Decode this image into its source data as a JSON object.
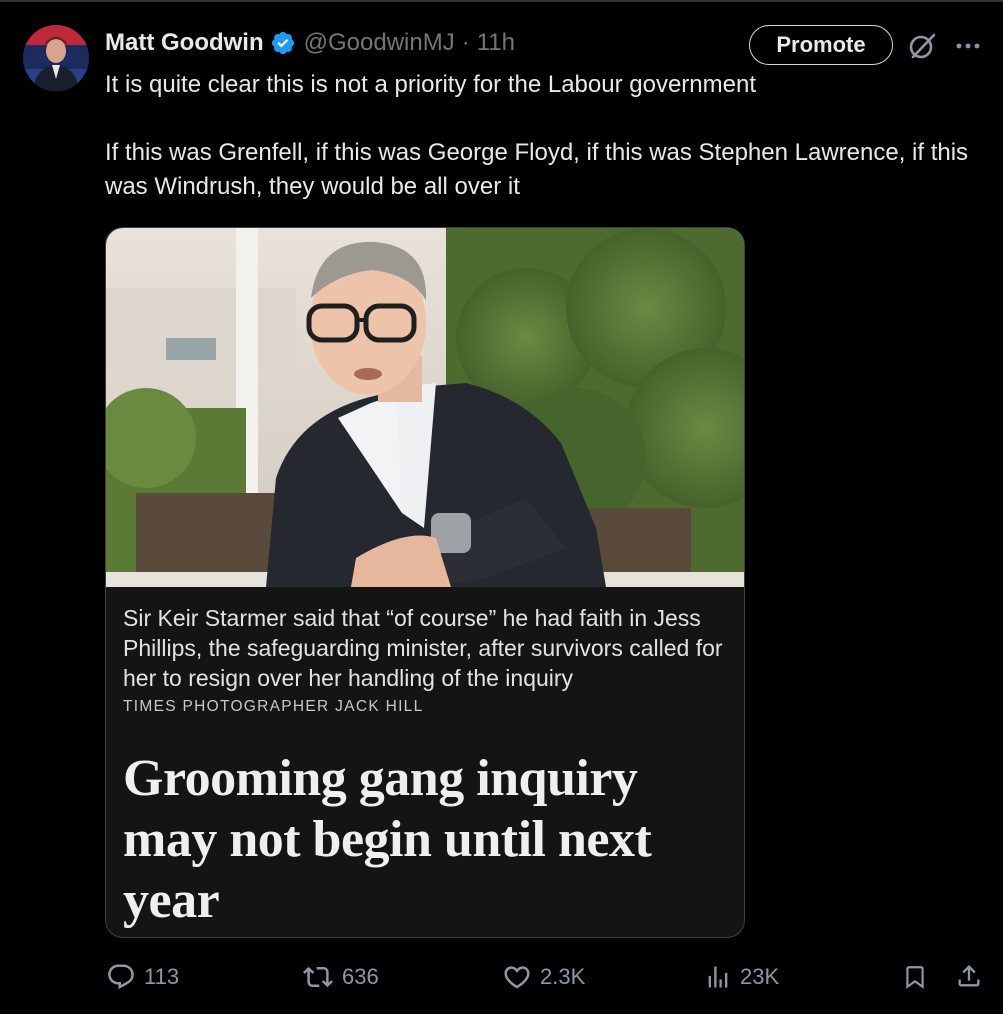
{
  "tweet": {
    "author": {
      "display_name": "Matt Goodwin",
      "handle": "@GoodwinMJ",
      "verified": true
    },
    "separator": "·",
    "timestamp": "11h",
    "promote_label": "Promote",
    "text_paragraphs": [
      "It is quite clear this is not a priority for the Labour government",
      "If this was Grenfell, if this was George Floyd, if this was Stephen Lawrence, if this was Windrush, they would be all over it"
    ],
    "media": {
      "caption": "Sir Keir Starmer said that “of course” he had faith in Jess Phillips, the safeguarding minister, after survivors called for her to resign over her handling of the inquiry",
      "credit": "TIMES PHOTOGRAPHER JACK HILL",
      "headline": "Grooming gang inquiry may not begin until next year"
    },
    "actions": {
      "replies": "113",
      "reposts": "636",
      "likes": "2.3K",
      "views": "23K"
    }
  },
  "icons": {
    "verified": "verified-badge-icon",
    "grok": "grok-icon",
    "more": "more-icon",
    "reply": "reply-icon",
    "repost": "repost-icon",
    "like": "heart-icon",
    "views": "views-icon",
    "bookmark": "bookmark-icon",
    "share": "share-icon"
  },
  "colors": {
    "background": "#000000",
    "text_primary": "#e7e9ea",
    "text_secondary": "#71767b",
    "action_gray": "#8b98a5",
    "verified_blue": "#1d9bf0",
    "card_background": "#141414"
  }
}
